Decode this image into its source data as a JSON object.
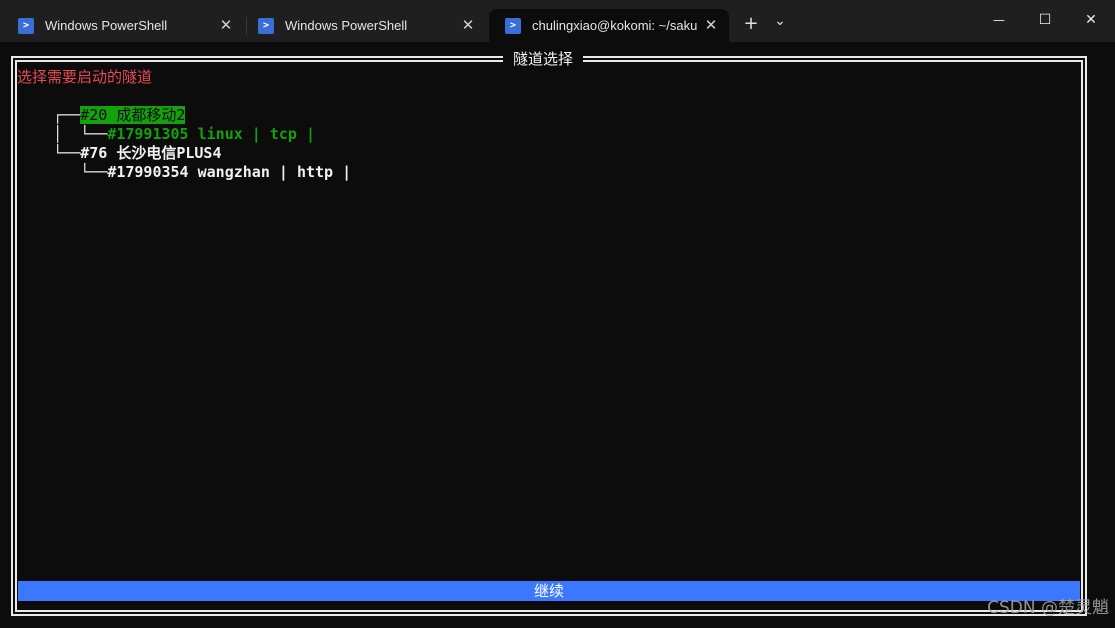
{
  "tabs": [
    {
      "title": "Windows PowerShell",
      "icon": "powershell-icon",
      "active": false
    },
    {
      "title": "Windows PowerShell",
      "icon": "powershell-icon",
      "active": false
    },
    {
      "title": "chulingxiao@kokomi: ~/sakur",
      "icon": "powershell-icon",
      "active": true
    }
  ],
  "tabbar": {
    "new_tab": "+",
    "dropdown": "⌄"
  },
  "window": {
    "minimize": "—",
    "maximize": "☐",
    "close": "✕"
  },
  "dialog": {
    "title": "隧道选择",
    "prompt": "选择需要启动的隧道",
    "nodes": [
      {
        "branch": "┌─",
        "label": "#20 成都移动2",
        "child_branch": "└─",
        "child": "#17991305 linux | tcp |"
      },
      {
        "branch": "└─",
        "label": "#76 长沙电信PLUS4",
        "child_branch": "└─",
        "child": "#17990354 wangzhan | http |"
      }
    ],
    "continue_label": "继续"
  },
  "watermark": "CSDN @楚灵魈",
  "colors": {
    "accent": "#3b78ff",
    "selected_bg": "#13a10e",
    "prompt": "#e74856",
    "background": "#0c0c0c"
  }
}
